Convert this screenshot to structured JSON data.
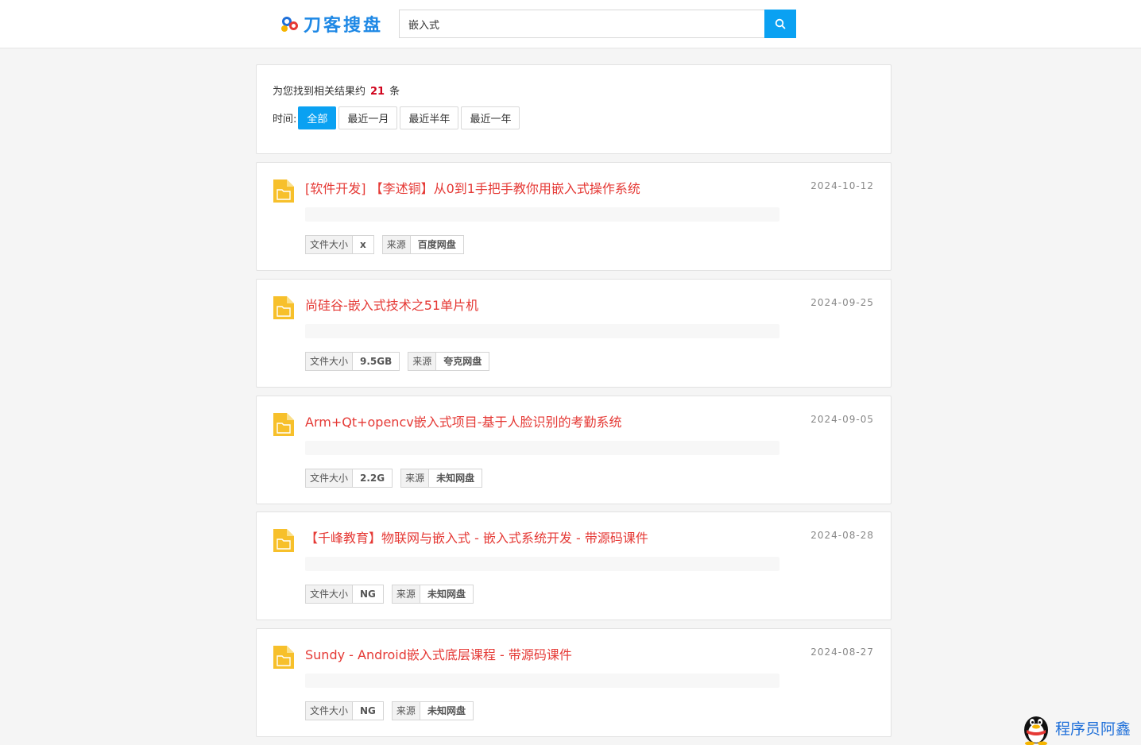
{
  "header": {
    "logo_text": "刀客搜盘",
    "search_value": "嵌入式",
    "search_icon": "search-icon"
  },
  "summary": {
    "prefix": "为您找到相关结果约",
    "count": "21",
    "suffix": "条",
    "time_label": "时间:",
    "time_filters": [
      "全部",
      "最近一月",
      "最近半年",
      "最近一年"
    ],
    "active_filter": "全部",
    "accent": "#0aa1f2"
  },
  "results": [
    {
      "title": "[软件开发] 【李述铜】从0到1手把手教你用嵌入式操作系统",
      "date": "2024-10-12",
      "size_label": "文件大小",
      "size": "x",
      "source_label": "来源",
      "source": "百度网盘"
    },
    {
      "title": "尚硅谷-嵌入式技术之51单片机",
      "date": "2024-09-25",
      "size_label": "文件大小",
      "size": "9.5GB",
      "source_label": "来源",
      "source": "夸克网盘"
    },
    {
      "title": "Arm+Qt+opencv嵌入式项目-基于人脸识别的考勤系统",
      "date": "2024-09-05",
      "size_label": "文件大小",
      "size": "2.2G",
      "source_label": "来源",
      "source": "未知网盘"
    },
    {
      "title": "【千峰教育】物联网与嵌入式 - 嵌入式系统开发 - 带源码课件",
      "date": "2024-08-28",
      "size_label": "文件大小",
      "size": "NG",
      "source_label": "来源",
      "source": "未知网盘"
    },
    {
      "title": "Sundy - Android嵌入式底层课程 - 带源码课件",
      "date": "2024-08-27",
      "size_label": "文件大小",
      "size": "NG",
      "source_label": "来源",
      "source": "未知网盘"
    }
  ],
  "colors": {
    "title_red": "#e53935",
    "folder_yellow": "#f7c02b"
  },
  "watermark": {
    "text": "程序员阿鑫",
    "icon": "qq-penguin-icon"
  }
}
